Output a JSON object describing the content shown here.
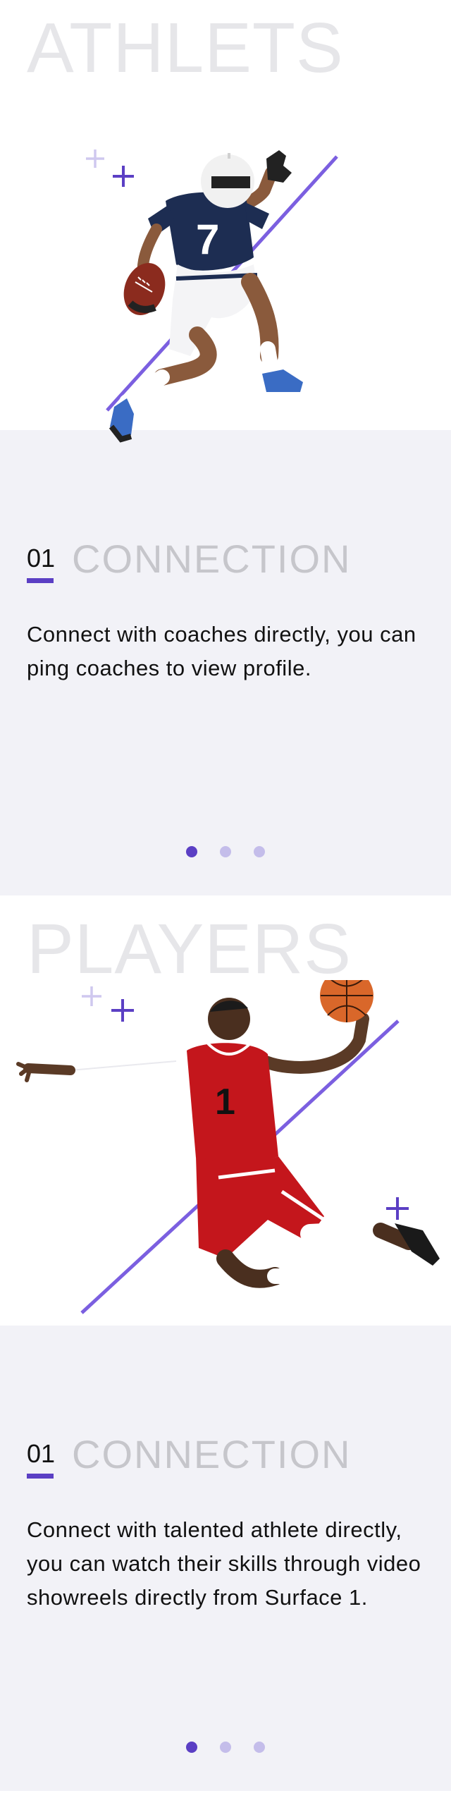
{
  "colors": {
    "accent": "#5b3fc4",
    "accent_light": "#c4bdea",
    "panel_bg": "#f2f2f7",
    "bg_title": "#e6e6e9",
    "section_title": "#c6c6cb"
  },
  "screens": [
    {
      "bg_title": "ATHLETS",
      "image_icon": "football-player-image",
      "section": {
        "number": "01",
        "title": "CONNECTION"
      },
      "description": "Connect with coaches directly, you can ping coaches to view profile.",
      "pagination": {
        "count": 3,
        "active": 1
      }
    },
    {
      "bg_title": "PLAYERS",
      "image_icon": "basketball-player-image",
      "section": {
        "number": "01",
        "title": "CONNECTION"
      },
      "description": "Connect with talented athlete directly, you can watch their skills through video showreels directly from Surface 1.",
      "pagination": {
        "count": 3,
        "active": 1
      }
    }
  ]
}
